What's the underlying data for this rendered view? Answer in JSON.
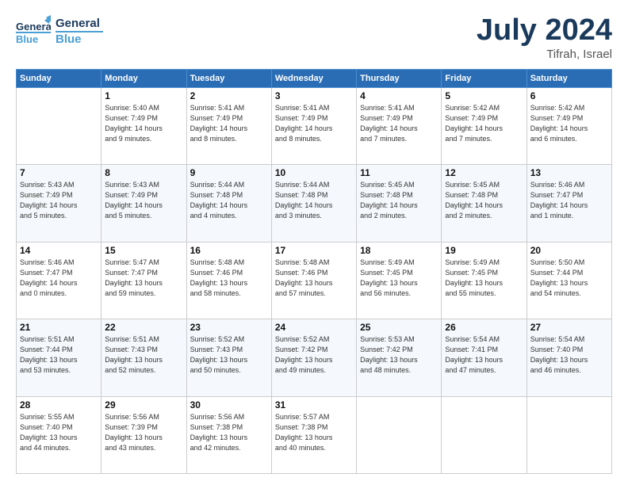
{
  "header": {
    "logo_line1": "General",
    "logo_line2": "Blue",
    "title": "July 2024",
    "location": "Tifrah, Israel"
  },
  "days_of_week": [
    "Sunday",
    "Monday",
    "Tuesday",
    "Wednesday",
    "Thursday",
    "Friday",
    "Saturday"
  ],
  "weeks": [
    [
      {
        "day": "",
        "info": ""
      },
      {
        "day": "1",
        "info": "Sunrise: 5:40 AM\nSunset: 7:49 PM\nDaylight: 14 hours\nand 9 minutes."
      },
      {
        "day": "2",
        "info": "Sunrise: 5:41 AM\nSunset: 7:49 PM\nDaylight: 14 hours\nand 8 minutes."
      },
      {
        "day": "3",
        "info": "Sunrise: 5:41 AM\nSunset: 7:49 PM\nDaylight: 14 hours\nand 8 minutes."
      },
      {
        "day": "4",
        "info": "Sunrise: 5:41 AM\nSunset: 7:49 PM\nDaylight: 14 hours\nand 7 minutes."
      },
      {
        "day": "5",
        "info": "Sunrise: 5:42 AM\nSunset: 7:49 PM\nDaylight: 14 hours\nand 7 minutes."
      },
      {
        "day": "6",
        "info": "Sunrise: 5:42 AM\nSunset: 7:49 PM\nDaylight: 14 hours\nand 6 minutes."
      }
    ],
    [
      {
        "day": "7",
        "info": "Sunrise: 5:43 AM\nSunset: 7:49 PM\nDaylight: 14 hours\nand 5 minutes."
      },
      {
        "day": "8",
        "info": "Sunrise: 5:43 AM\nSunset: 7:49 PM\nDaylight: 14 hours\nand 5 minutes."
      },
      {
        "day": "9",
        "info": "Sunrise: 5:44 AM\nSunset: 7:48 PM\nDaylight: 14 hours\nand 4 minutes."
      },
      {
        "day": "10",
        "info": "Sunrise: 5:44 AM\nSunset: 7:48 PM\nDaylight: 14 hours\nand 3 minutes."
      },
      {
        "day": "11",
        "info": "Sunrise: 5:45 AM\nSunset: 7:48 PM\nDaylight: 14 hours\nand 2 minutes."
      },
      {
        "day": "12",
        "info": "Sunrise: 5:45 AM\nSunset: 7:48 PM\nDaylight: 14 hours\nand 2 minutes."
      },
      {
        "day": "13",
        "info": "Sunrise: 5:46 AM\nSunset: 7:47 PM\nDaylight: 14 hours\nand 1 minute."
      }
    ],
    [
      {
        "day": "14",
        "info": "Sunrise: 5:46 AM\nSunset: 7:47 PM\nDaylight: 14 hours\nand 0 minutes."
      },
      {
        "day": "15",
        "info": "Sunrise: 5:47 AM\nSunset: 7:47 PM\nDaylight: 13 hours\nand 59 minutes."
      },
      {
        "day": "16",
        "info": "Sunrise: 5:48 AM\nSunset: 7:46 PM\nDaylight: 13 hours\nand 58 minutes."
      },
      {
        "day": "17",
        "info": "Sunrise: 5:48 AM\nSunset: 7:46 PM\nDaylight: 13 hours\nand 57 minutes."
      },
      {
        "day": "18",
        "info": "Sunrise: 5:49 AM\nSunset: 7:45 PM\nDaylight: 13 hours\nand 56 minutes."
      },
      {
        "day": "19",
        "info": "Sunrise: 5:49 AM\nSunset: 7:45 PM\nDaylight: 13 hours\nand 55 minutes."
      },
      {
        "day": "20",
        "info": "Sunrise: 5:50 AM\nSunset: 7:44 PM\nDaylight: 13 hours\nand 54 minutes."
      }
    ],
    [
      {
        "day": "21",
        "info": "Sunrise: 5:51 AM\nSunset: 7:44 PM\nDaylight: 13 hours\nand 53 minutes."
      },
      {
        "day": "22",
        "info": "Sunrise: 5:51 AM\nSunset: 7:43 PM\nDaylight: 13 hours\nand 52 minutes."
      },
      {
        "day": "23",
        "info": "Sunrise: 5:52 AM\nSunset: 7:43 PM\nDaylight: 13 hours\nand 50 minutes."
      },
      {
        "day": "24",
        "info": "Sunrise: 5:52 AM\nSunset: 7:42 PM\nDaylight: 13 hours\nand 49 minutes."
      },
      {
        "day": "25",
        "info": "Sunrise: 5:53 AM\nSunset: 7:42 PM\nDaylight: 13 hours\nand 48 minutes."
      },
      {
        "day": "26",
        "info": "Sunrise: 5:54 AM\nSunset: 7:41 PM\nDaylight: 13 hours\nand 47 minutes."
      },
      {
        "day": "27",
        "info": "Sunrise: 5:54 AM\nSunset: 7:40 PM\nDaylight: 13 hours\nand 46 minutes."
      }
    ],
    [
      {
        "day": "28",
        "info": "Sunrise: 5:55 AM\nSunset: 7:40 PM\nDaylight: 13 hours\nand 44 minutes."
      },
      {
        "day": "29",
        "info": "Sunrise: 5:56 AM\nSunset: 7:39 PM\nDaylight: 13 hours\nand 43 minutes."
      },
      {
        "day": "30",
        "info": "Sunrise: 5:56 AM\nSunset: 7:38 PM\nDaylight: 13 hours\nand 42 minutes."
      },
      {
        "day": "31",
        "info": "Sunrise: 5:57 AM\nSunset: 7:38 PM\nDaylight: 13 hours\nand 40 minutes."
      },
      {
        "day": "",
        "info": ""
      },
      {
        "day": "",
        "info": ""
      },
      {
        "day": "",
        "info": ""
      }
    ]
  ]
}
